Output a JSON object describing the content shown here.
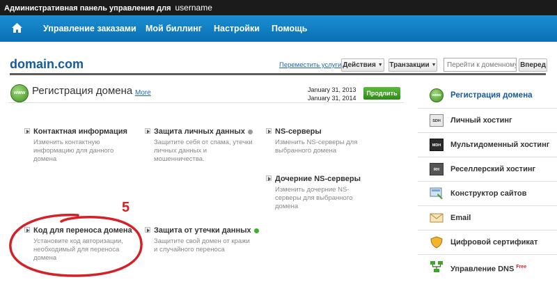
{
  "topbar": {
    "title": "Административная панель управления для",
    "username": "username"
  },
  "nav": {
    "home_icon": "home-icon",
    "items": [
      "Управление заказами",
      "Мой биллинг",
      "Настройки",
      "Помощь"
    ]
  },
  "domain": {
    "name": "domain.com",
    "move_link": "Переместить услуги",
    "actions_label": "Действия",
    "transactions_label": "Транзакции",
    "jump_placeholder": "Перейти к доменному",
    "go_label": "Вперед"
  },
  "card": {
    "icon_text": "www",
    "title": "Регистрация домена",
    "more": "More",
    "date1": "January 31, 2013",
    "date2": "January 31, 2014",
    "renew": "Продлить"
  },
  "features": [
    {
      "title": "Контактная информация",
      "desc": "Изменить контактную информацию для данного домена"
    },
    {
      "title": "Защита личных данных",
      "desc": "Защитите себя от спама, утечки личных данных и мошенничества.",
      "status_color": "#9a9a9a"
    },
    {
      "title": "NS-серверы",
      "desc": "Изменить NS-серверы для выбранного домена"
    },
    {
      "title": "Дочерние NS-серверы",
      "desc": "Изменить дочерние NS-серверы для выбранного домена"
    },
    {
      "title": "Код для переноса домена",
      "desc": "Установите код авторизации, необходимый для переноса домена"
    },
    {
      "title": "Защита от утечки данных",
      "desc": "Защитите свой домен от кражи и случайного переноса",
      "status_color": "#3fb02a"
    }
  ],
  "annotation": {
    "number": "5",
    "color": "#d42026"
  },
  "sidebar": [
    {
      "label": "Регистрация домена",
      "icon": "www-globe-icon",
      "icon_text": "www"
    },
    {
      "label": "Личный хостинг",
      "icon": "sdh-server-icon",
      "icon_text": "SDH"
    },
    {
      "label": "Мультидоменный хостинг",
      "icon": "mdh-server-icon",
      "icon_text": "MDH"
    },
    {
      "label": "Реселлерский хостинг",
      "icon": "rh-server-icon",
      "icon_text": "RH"
    },
    {
      "label": "Конструктор сайтов",
      "icon": "site-builder-icon",
      "icon_text": ""
    },
    {
      "label": "Email",
      "icon": "envelope-icon",
      "icon_text": ""
    },
    {
      "label": "Цифровой сертификат",
      "icon": "shield-icon",
      "icon_text": ""
    },
    {
      "label": "Управление DNS",
      "icon": "dns-network-icon",
      "icon_text": "",
      "badge": "Free"
    }
  ],
  "colors": {
    "nav": "#0b6fb5",
    "accent": "#145a9c",
    "renew": "#3a9a22",
    "annotation": "#d42026"
  }
}
